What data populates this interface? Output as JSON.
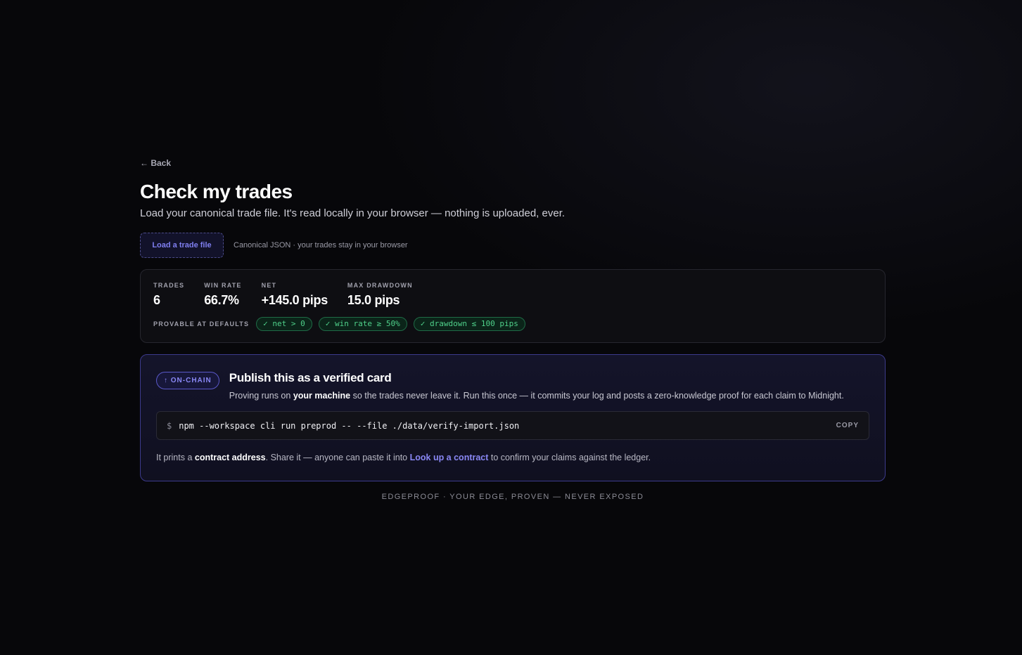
{
  "nav": {
    "back_label": "← Back"
  },
  "header": {
    "title": "Check my trades",
    "subtitle": "Load your canonical trade file. It's read locally in your browser — nothing is uploaded, ever."
  },
  "loader": {
    "button_label": "Load a trade file",
    "note": "Canonical JSON · your trades stay in your browser"
  },
  "stats": {
    "items": [
      {
        "label": "TRADES",
        "value": "6"
      },
      {
        "label": "WIN RATE",
        "value": "66.7%"
      },
      {
        "label": "NET",
        "value": "+145.0 pips"
      },
      {
        "label": "MAX DRAWDOWN",
        "value": "15.0 pips"
      }
    ],
    "provable_label": "PROVABLE AT DEFAULTS",
    "claims": [
      "✓ net > 0",
      "✓ win rate ≥ 50%",
      "✓ drawdown ≤ 100 pips"
    ]
  },
  "publish": {
    "badge": "↑ ON-CHAIN",
    "title": "Publish this as a verified card",
    "desc_before": "Proving runs on ",
    "desc_bold": "your machine",
    "desc_after": " so the trades never leave it. Run this once — it commits your log and posts a zero-knowledge proof for each claim to Midnight.",
    "prompt": "$",
    "command": "npm --workspace cli run preprod -- --file ./data/verify-import.json",
    "copy_label": "COPY",
    "foot_before": "It prints a ",
    "foot_bold": "contract address",
    "foot_middle": ". Share it — anyone can paste it into ",
    "foot_link": "Look up a contract",
    "foot_after": " to confirm your claims against the ledger."
  },
  "footer": {
    "text": "EDGEPROOF · YOUR EDGE, PROVEN — NEVER EXPOSED"
  },
  "colors": {
    "background": "#07070a",
    "accent": "#8a88f5",
    "success": "#4fd08a"
  }
}
